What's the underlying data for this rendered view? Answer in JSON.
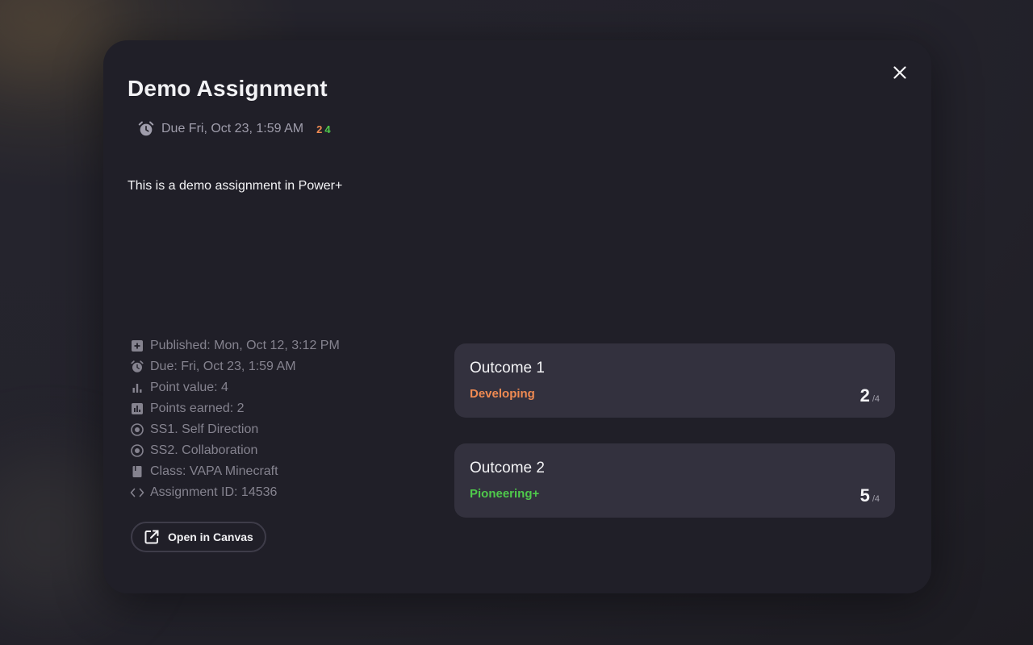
{
  "colors": {
    "developing": "#ef8a52",
    "pioneering": "#4fc94b",
    "muted_text": "#85838f",
    "card_bg": "#33313e",
    "modal_bg": "#201f28"
  },
  "modal": {
    "title": "Demo Assignment",
    "due_text": "Due Fri, Oct 23, 1:59 AM",
    "badge_1": "2",
    "badge_2": "4",
    "description": "This is a demo assignment in Power+",
    "close_icon": "close-icon"
  },
  "meta": {
    "published": "Published: Mon, Oct 12, 3:12 PM",
    "due": "Due: Fri, Oct 23, 1:59 AM",
    "point_value": "Point value: 4",
    "points_earned": "Points earned: 2",
    "ss1": "SS1. Self Direction",
    "ss2": "SS2. Collaboration",
    "class": "Class: VAPA Minecraft",
    "assignment_id": "Assignment ID: 14536"
  },
  "open_button": {
    "label": "Open in Canvas",
    "icon": "external-link-icon"
  },
  "outcomes": [
    {
      "title": "Outcome 1",
      "level": "Developing",
      "score": "2",
      "denominator": "/4"
    },
    {
      "title": "Outcome 2",
      "level": "Pioneering+",
      "score": "5",
      "denominator": "/4"
    }
  ]
}
